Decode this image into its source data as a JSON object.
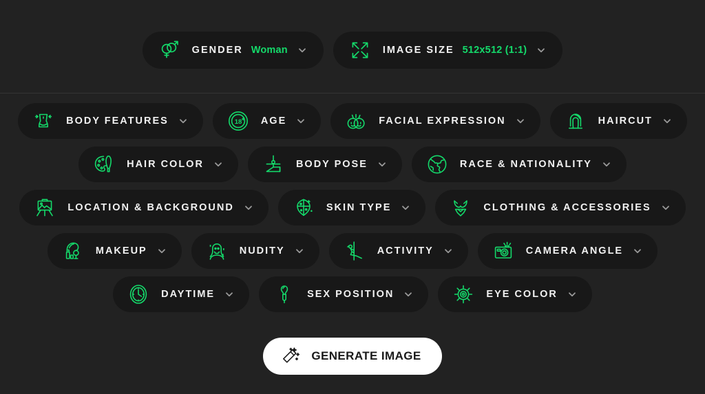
{
  "theme": {
    "page_background": "#222222",
    "pill_background": "#181818",
    "accent_green": "#14d96a",
    "label_color": "#f1f1f1",
    "chevron_color": "#9a9a9a",
    "divider_color": "#343434",
    "generate_background": "#ffffff",
    "generate_text_color": "#1a1a1a"
  },
  "top_row": [
    {
      "label": "GENDER",
      "value": "Woman",
      "icon": "gender-symbols-icon",
      "chevron": "chevron-down-icon"
    },
    {
      "label": "IMAGE SIZE",
      "value": "512x512 (1:1)",
      "icon": "resize-arrows-icon",
      "chevron": "chevron-down-icon"
    }
  ],
  "option_rows": [
    {
      "items": [
        {
          "label": "BODY FEATURES",
          "icon": "body-figure-icon",
          "chevron": "chevron-down-icon"
        },
        {
          "label": "AGE",
          "icon": "eighteen-plus-icon",
          "chevron": "chevron-down-icon"
        },
        {
          "label": "FACIAL EXPRESSION",
          "icon": "smiling-faces-icon",
          "chevron": "chevron-down-icon"
        },
        {
          "label": "HAIRCUT",
          "icon": "hairstyle-head-icon",
          "chevron": "chevron-down-icon"
        }
      ]
    },
    {
      "items": [
        {
          "label": "HAIR COLOR",
          "icon": "palette-brush-icon",
          "chevron": "chevron-down-icon"
        },
        {
          "label": "BODY POSE",
          "icon": "yoga-pose-icon",
          "chevron": "chevron-down-icon"
        },
        {
          "label": "RACE & NATIONALITY",
          "icon": "globe-icon",
          "chevron": "chevron-down-icon"
        }
      ]
    },
    {
      "items": [
        {
          "label": "LOCATION & BACKGROUND",
          "icon": "easel-landscape-icon",
          "chevron": "chevron-down-icon"
        },
        {
          "label": "SKIN TYPE",
          "icon": "skin-scan-icon",
          "chevron": "chevron-down-icon"
        },
        {
          "label": "CLOTHING & ACCESSORIES",
          "icon": "lingerie-icon",
          "chevron": "chevron-down-icon"
        }
      ]
    },
    {
      "items": [
        {
          "label": "MAKEUP",
          "icon": "makeup-kit-icon",
          "chevron": "chevron-down-icon"
        },
        {
          "label": "NUDITY",
          "icon": "woman-portrait-icon",
          "chevron": "chevron-down-icon"
        },
        {
          "label": "ACTIVITY",
          "icon": "pole-dance-icon",
          "chevron": "chevron-down-icon"
        },
        {
          "label": "CAMERA ANGLE",
          "icon": "camera-icon",
          "chevron": "chevron-down-icon"
        }
      ]
    },
    {
      "items": [
        {
          "label": "DAYTIME",
          "icon": "clock-icon",
          "chevron": "chevron-down-icon"
        },
        {
          "label": "SEX POSITION",
          "icon": "position-figure-icon",
          "chevron": "chevron-down-icon"
        },
        {
          "label": "EYE COLOR",
          "icon": "eye-icon",
          "chevron": "chevron-down-icon"
        }
      ]
    }
  ],
  "generate": {
    "label": "GENERATE IMAGE",
    "icon": "magic-wand-icon"
  }
}
